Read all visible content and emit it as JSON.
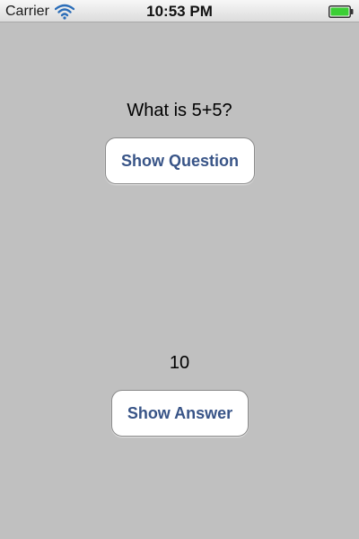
{
  "status_bar": {
    "carrier": "Carrier",
    "time": "10:53 PM",
    "icons": [
      "wifi-icon",
      "battery-icon"
    ],
    "battery_color": "#3bcf35"
  },
  "main": {
    "question": "What is 5+5?",
    "show_question_label": "Show Question",
    "answer": "10",
    "show_answer_label": "Show Answer"
  },
  "colors": {
    "background": "#c0c0c0",
    "button_text": "#385487",
    "button_bg": "#ffffff"
  }
}
